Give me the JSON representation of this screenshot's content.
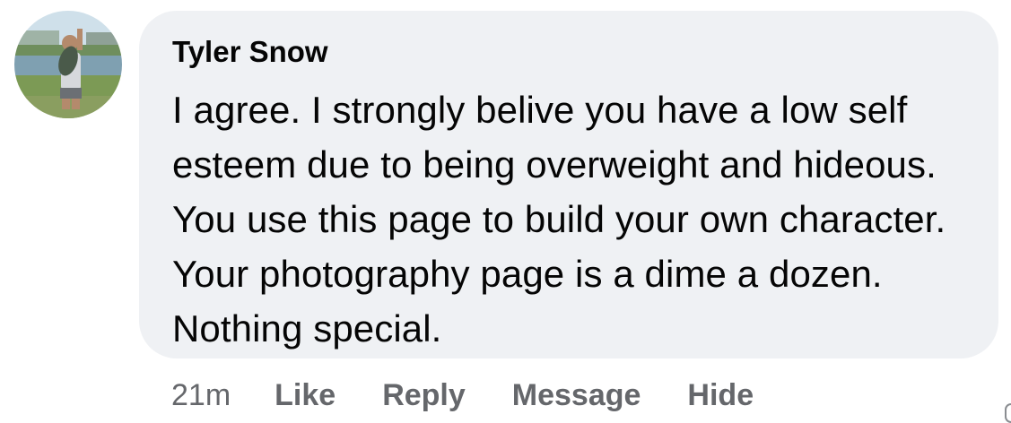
{
  "comment": {
    "author": "Tyler Snow",
    "text": "I agree. I strongly belive you have a low self esteem due to being overweight and hideous. You use this page to build your own character. Your photography page is a dime a dozen. Nothing special."
  },
  "actions": {
    "timestamp": "21m",
    "like_label": "Like",
    "reply_label": "Reply",
    "message_label": "Message",
    "hide_label": "Hide"
  },
  "colors": {
    "bubble_background": "#eff1f4",
    "text": "#050505",
    "secondary_text": "#65676b"
  }
}
